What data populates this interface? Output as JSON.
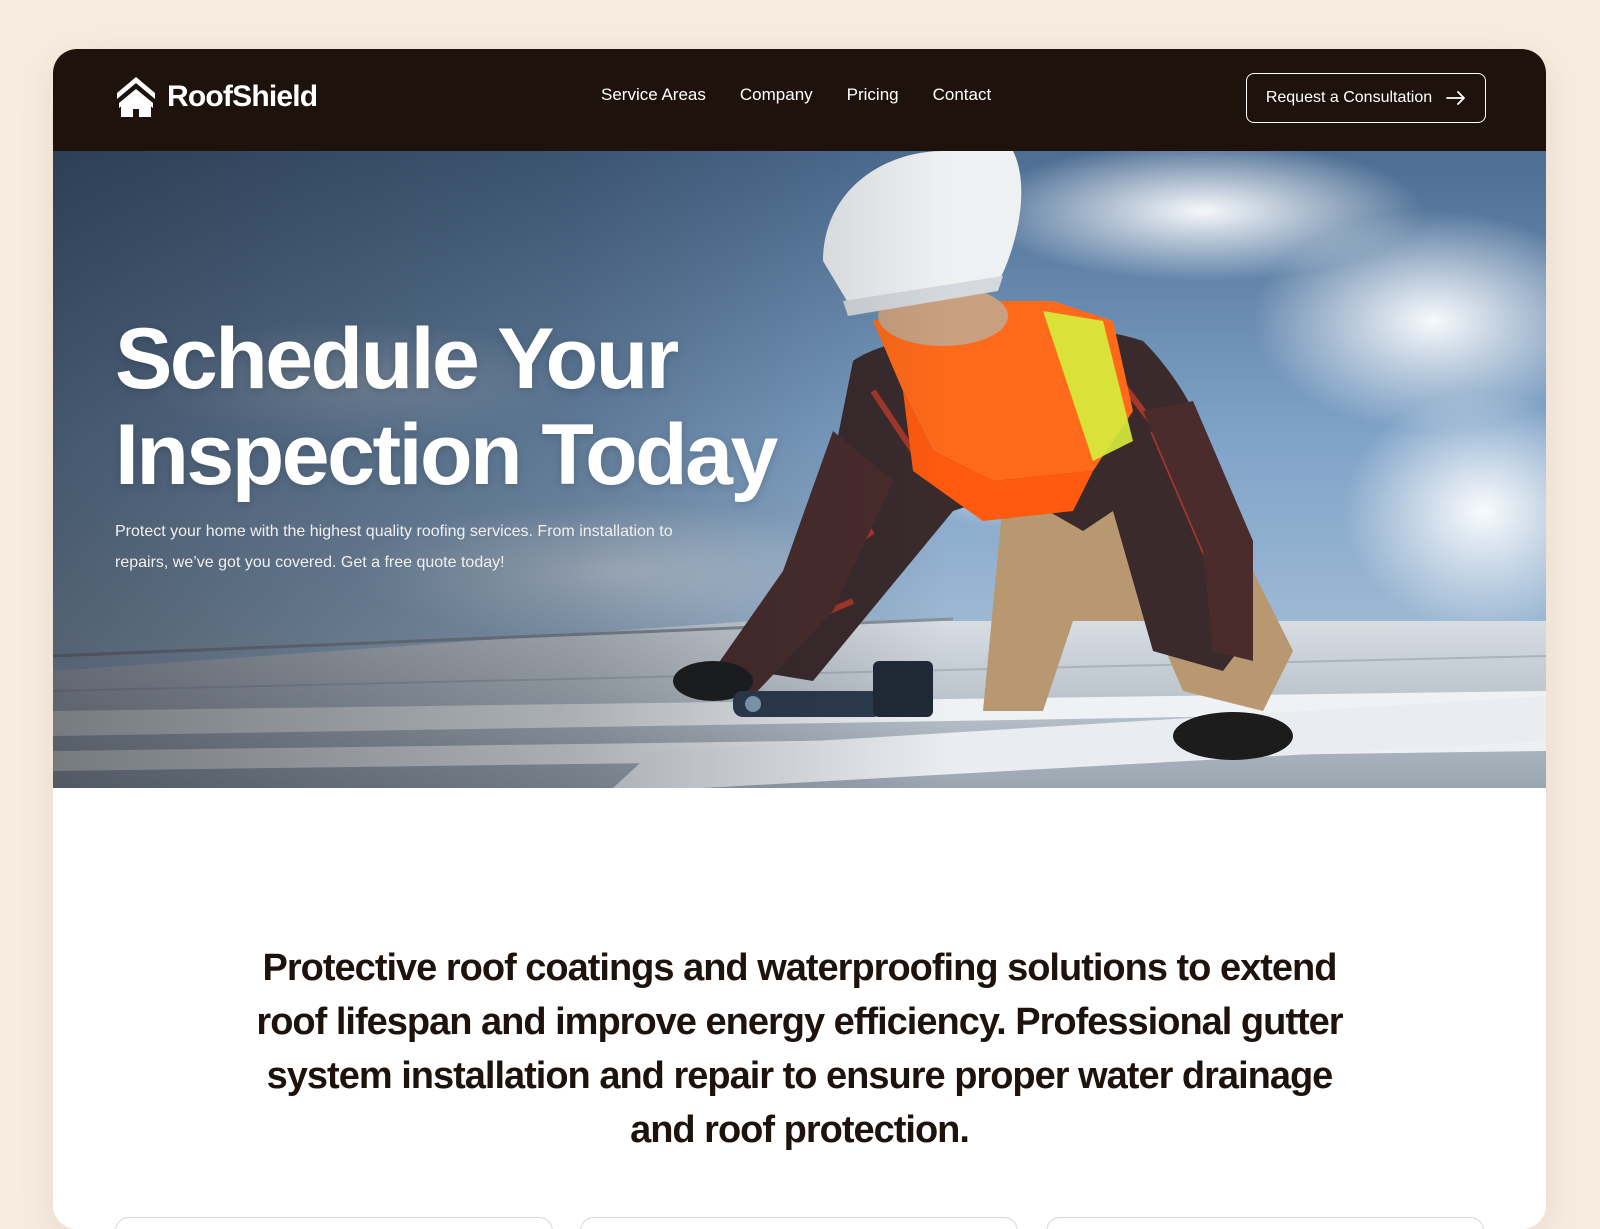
{
  "brand": {
    "name": "RoofShield"
  },
  "nav": {
    "links": [
      "Service Areas",
      "Company",
      "Pricing",
      "Contact"
    ],
    "cta_label": "Request a Consultation"
  },
  "hero": {
    "title": "Schedule Your Inspection Today",
    "subtitle": "Protect your home with the highest quality roofing services. From installation to repairs, we’ve got you covered. Get a free quote today!"
  },
  "statement": "Protective roof coatings and waterproofing solutions to extend roof lifespan and improve energy efficiency. Professional gutter system installation and repair to ensure proper water drainage and roof protection.",
  "colors": {
    "nav_background": "#1e130c",
    "page_background": "#f7ece0",
    "text_dark": "#1e130c",
    "vest_orange": "#ff6a1a"
  },
  "icons": [
    "house-shield-logo-icon",
    "arrow-right-icon"
  ]
}
